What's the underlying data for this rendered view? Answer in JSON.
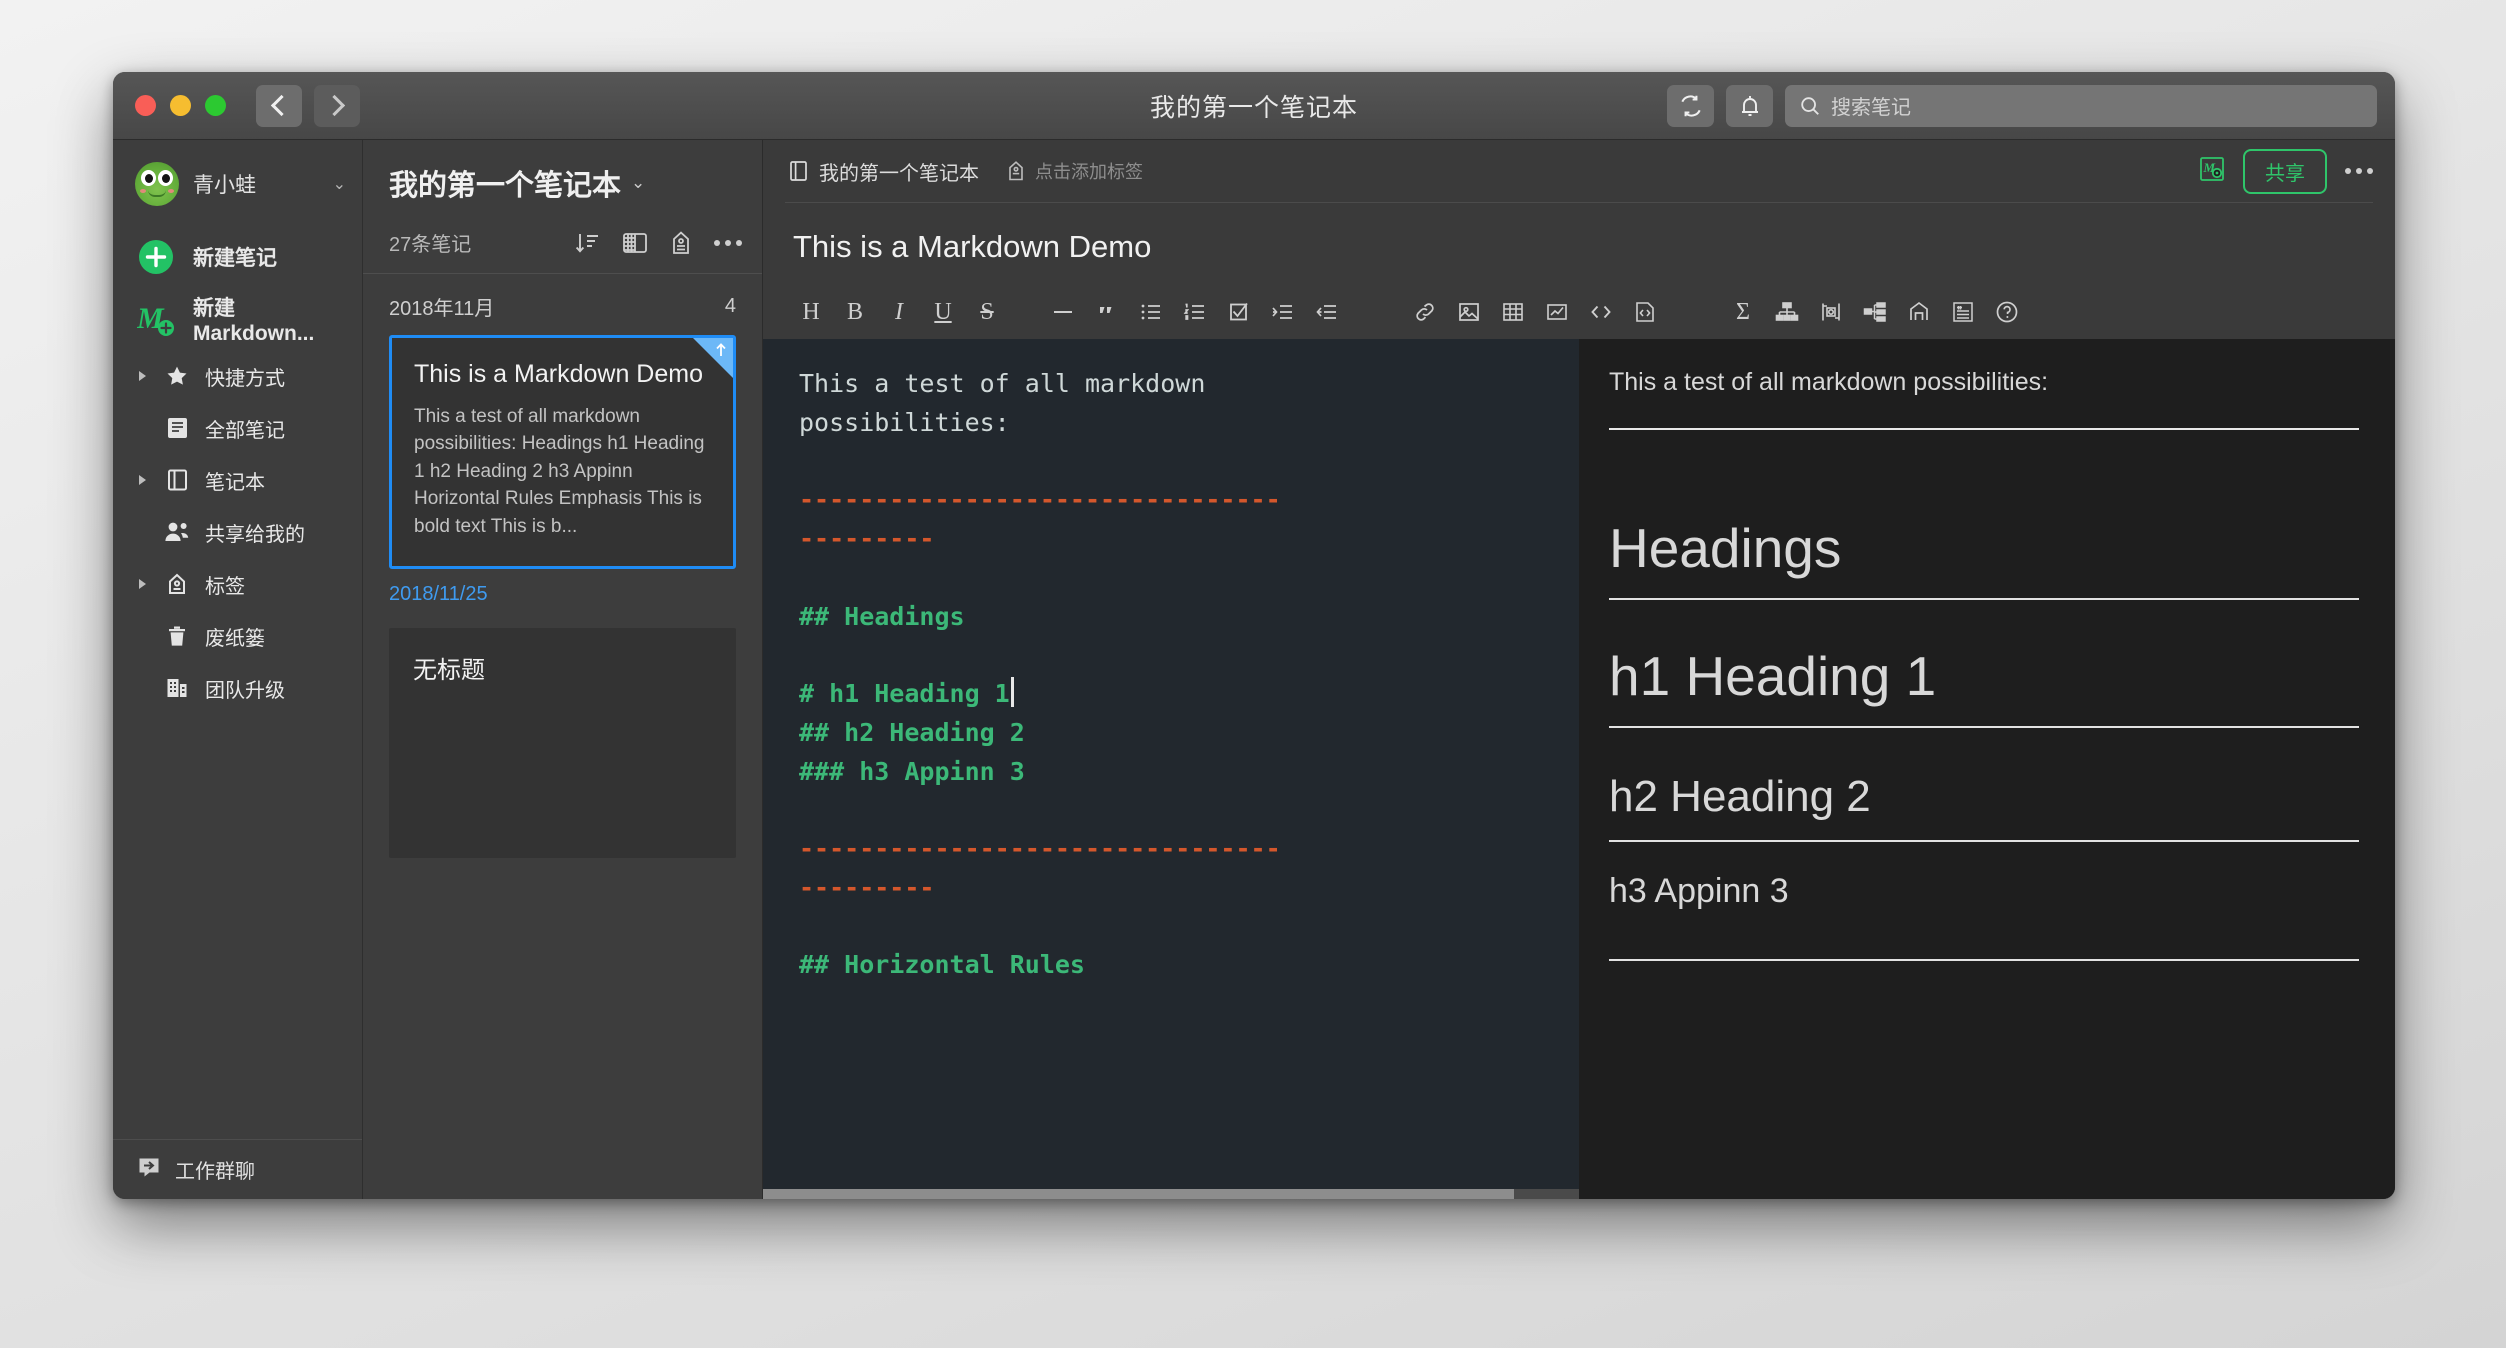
{
  "window": {
    "title": "我的第一个笔记本",
    "traffic_lights": [
      "close",
      "minimize",
      "maximize"
    ],
    "back_label": "后退",
    "forward_label": "前进",
    "sync_icon": "sync-icon",
    "bell_icon": "bell-icon"
  },
  "search": {
    "placeholder": "搜索笔记",
    "value": ""
  },
  "sidebar": {
    "account": {
      "name": "青小蛙",
      "avatar": "frog-avatar",
      "caret": "⌄"
    },
    "actions": [
      {
        "label": "新建笔记",
        "icon": "plus-circle-icon"
      },
      {
        "label": "新建Markdown...",
        "icon": "markdown-new-icon"
      }
    ],
    "items": [
      {
        "label": "快捷方式",
        "icon": "star-icon",
        "expandable": true
      },
      {
        "label": "全部笔记",
        "icon": "all-notes-icon",
        "expandable": false
      },
      {
        "label": "笔记本",
        "icon": "notebook-icon",
        "expandable": true
      },
      {
        "label": "共享给我的",
        "icon": "shared-users-icon",
        "expandable": false
      },
      {
        "label": "标签",
        "icon": "tag-icon",
        "expandable": true
      },
      {
        "label": "废纸篓",
        "icon": "trash-icon",
        "expandable": false
      },
      {
        "label": "团队升级",
        "icon": "building-icon",
        "expandable": false
      }
    ],
    "footer": {
      "label": "工作群聊",
      "icon": "chat-icon"
    }
  },
  "notelist": {
    "title": "我的第一个笔记本",
    "title_caret": "⌄",
    "count_label": "27条笔记",
    "tools": [
      {
        "name": "sort-icon"
      },
      {
        "name": "layout-icon"
      },
      {
        "name": "tag-icon"
      },
      {
        "name": "more-icon"
      }
    ],
    "group": {
      "label": "2018年11月",
      "count": "4"
    },
    "notes": [
      {
        "title": "This is a Markdown Demo",
        "snippet": "This a test of all markdown possibilities: Headings h1 Heading 1 h2 Heading 2 h3 Appinn Horizontal Rules Emphasis This is bold text This is b...",
        "date": "2018/11/25",
        "selected": true,
        "pinned": true
      },
      {
        "title": "无标题",
        "snippet": "",
        "date": "",
        "selected": false,
        "pinned": false
      }
    ]
  },
  "editor": {
    "breadcrumb_notebook": "我的第一个笔记本",
    "breadcrumb_icon": "notebook-icon",
    "tag_icon": "tag-icon",
    "tag_placeholder": "点击添加标签",
    "markdown_badge_icon": "markdown-badge-icon",
    "share_label": "共享",
    "more_icon": "more-icon",
    "note_title": "This is a Markdown Demo",
    "toolbar": [
      {
        "name": "heading-icon",
        "glyph": "H"
      },
      {
        "name": "bold-icon",
        "glyph": "B"
      },
      {
        "name": "italic-icon",
        "glyph": "I"
      },
      {
        "name": "underline-icon",
        "glyph": "U"
      },
      {
        "name": "strikethrough-icon",
        "glyph": "S"
      },
      {
        "name": "horizontal-rule-icon",
        "glyph": "—"
      },
      {
        "name": "blockquote-icon",
        "glyph": "“"
      },
      {
        "name": "bullet-list-icon",
        "glyph": ""
      },
      {
        "name": "numbered-list-icon",
        "glyph": ""
      },
      {
        "name": "checklist-icon",
        "glyph": ""
      },
      {
        "name": "indent-icon",
        "glyph": ""
      },
      {
        "name": "outdent-icon",
        "glyph": ""
      },
      {
        "name": "link-icon",
        "glyph": ""
      },
      {
        "name": "image-icon",
        "glyph": ""
      },
      {
        "name": "table-icon",
        "glyph": ""
      },
      {
        "name": "chart-icon",
        "glyph": ""
      },
      {
        "name": "inline-code-icon",
        "glyph": ""
      },
      {
        "name": "code-block-icon",
        "glyph": ""
      },
      {
        "name": "formula-icon",
        "glyph": "Σ"
      },
      {
        "name": "flowchart-icon",
        "glyph": ""
      },
      {
        "name": "sequence-diagram-icon",
        "glyph": ""
      },
      {
        "name": "mindmap-icon",
        "glyph": ""
      },
      {
        "name": "gantt-icon",
        "glyph": ""
      },
      {
        "name": "toc-icon",
        "glyph": ""
      },
      {
        "name": "help-icon",
        "glyph": "?"
      }
    ]
  },
  "source": {
    "line1": "This a test of all markdown",
    "line2": "possibilities:",
    "hr_long": "--------------------------------",
    "hr_short": "---------",
    "h_headings": "## Headings",
    "h_h1": "# h1 Heading 1",
    "h_h2": "## h2 Heading 2",
    "h_h3": "### h3 Appinn 3",
    "hr_long2": "--------------------------------",
    "hr_short2": "---------",
    "h_rules": "## Horizontal Rules"
  },
  "preview": {
    "intro": "This a test of all markdown possibilities:",
    "headings": "Headings",
    "h1": "h1 Heading 1",
    "h2": "h2 Heading 2",
    "h3": "h3 Appinn 3"
  },
  "colors": {
    "accent_green": "#2fc56a",
    "selection_blue": "#1f8cf5",
    "date_blue": "#3f9bf0",
    "md_heading_green": "#3cb878",
    "md_rule_orange": "#d4572c",
    "editor_bg": "#22282e",
    "preview_bg": "#1e1e1e"
  }
}
